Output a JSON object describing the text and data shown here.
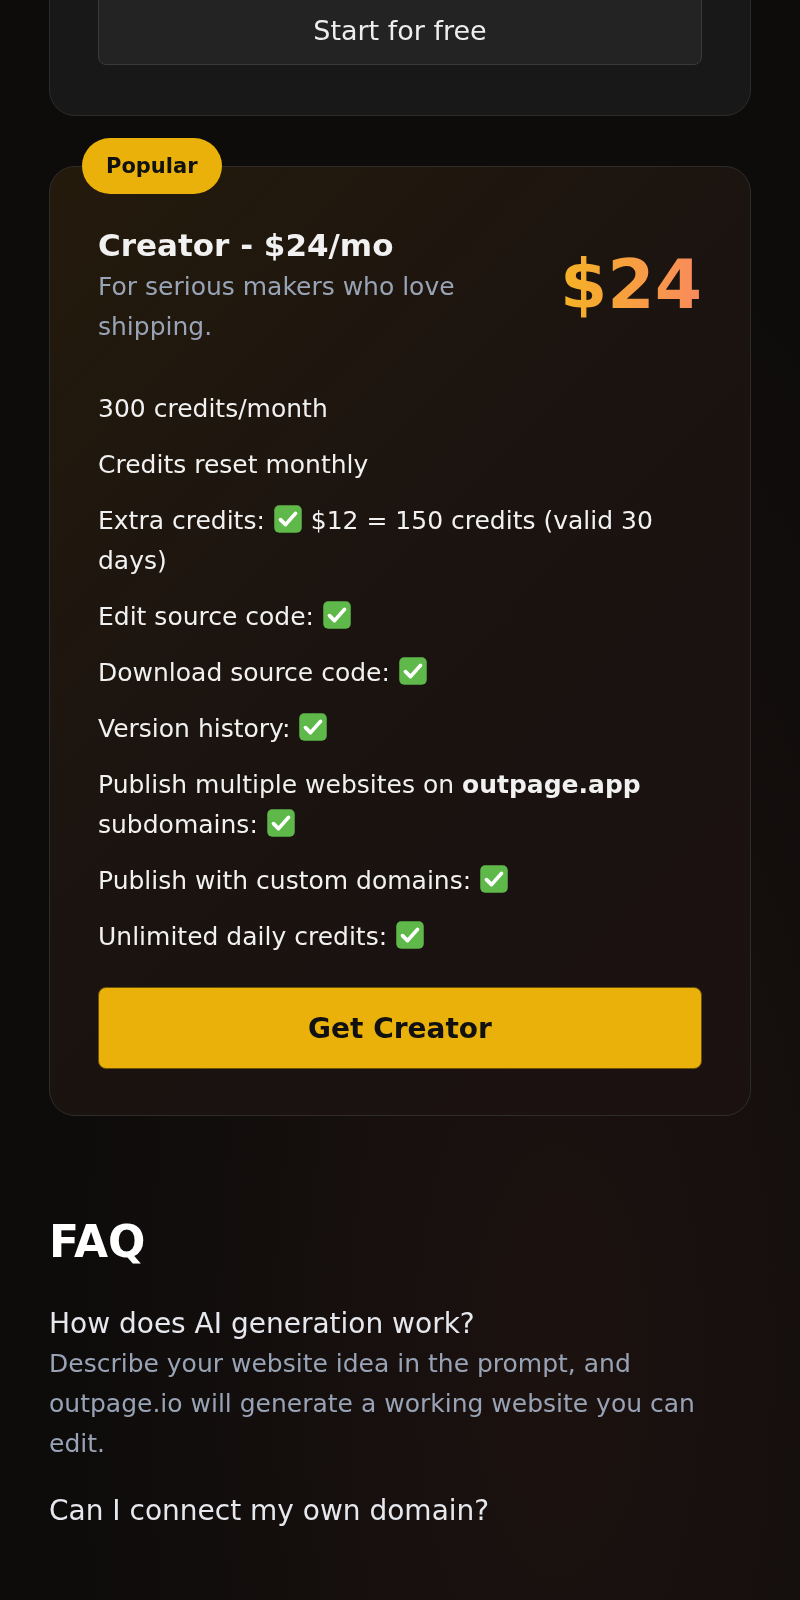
{
  "previous_plan": {
    "button": "Start for free"
  },
  "plan": {
    "badge": "Popular",
    "title": "Creator - $24/mo",
    "subtitle": "For serious makers who love shipping.",
    "price": "$24",
    "features": [
      {
        "label": "300 credits/month",
        "included": false
      },
      {
        "label": "Credits reset monthly",
        "included": false
      },
      {
        "label": "Extra credits:",
        "included": true,
        "detail": "$12 = 150 credits (valid 30 days)"
      },
      {
        "label": "Edit source code:",
        "included": true
      },
      {
        "label": "Download source code:",
        "included": true
      },
      {
        "label": "Version history:",
        "included": true
      },
      {
        "label": "Publish multiple websites on **outpage.app** subdomains:",
        "included": true
      },
      {
        "label": "Publish with custom domains:",
        "included": true
      },
      {
        "label": "Unlimited daily credits:",
        "included": true
      }
    ],
    "button": "Get Creator"
  },
  "faq": {
    "title": "FAQ",
    "items": [
      {
        "question": "How does AI generation work?",
        "answer": "Describe your website idea in the prompt, and outpage.io will generate a working website you can edit."
      },
      {
        "question": "Can I connect my own domain?"
      }
    ]
  }
}
